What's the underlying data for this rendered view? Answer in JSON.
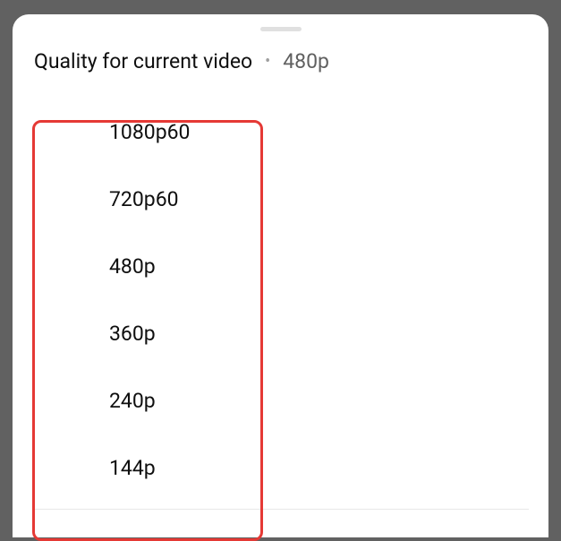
{
  "header": {
    "title": "Quality for current video",
    "separator": "•",
    "current": "480p"
  },
  "quality_options": [
    {
      "label": "1080p60"
    },
    {
      "label": "720p60"
    },
    {
      "label": "480p"
    },
    {
      "label": "360p"
    },
    {
      "label": "240p"
    },
    {
      "label": "144p"
    }
  ]
}
